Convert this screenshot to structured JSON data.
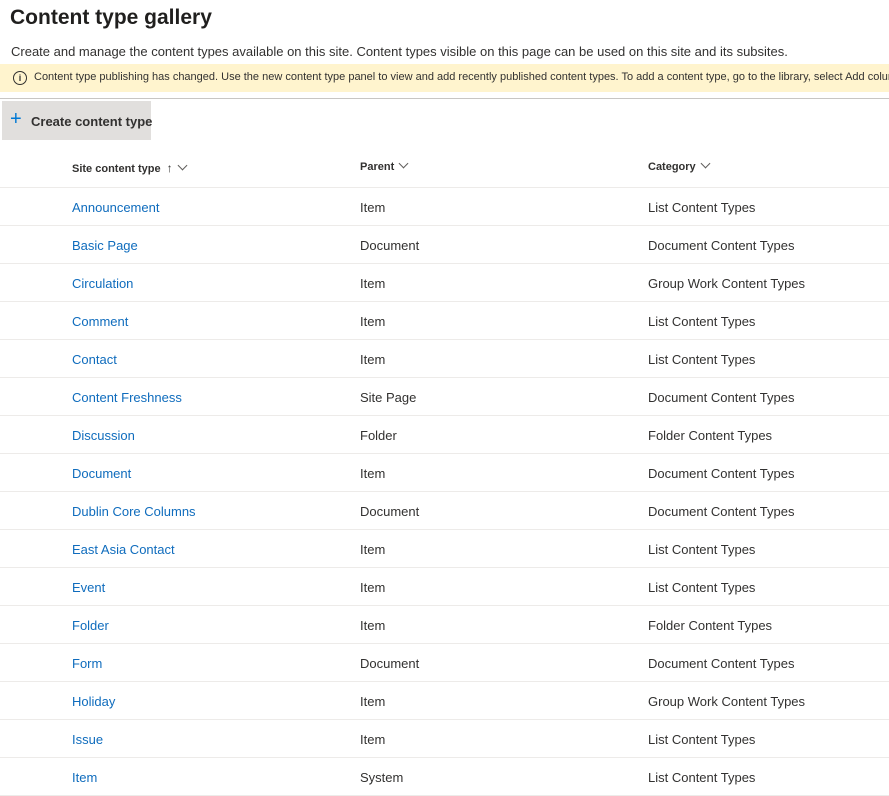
{
  "page": {
    "title": "Content type gallery",
    "description": "Create and manage the content types available on this site. Content types visible on this page can be used on this site and its subsites."
  },
  "notice": {
    "icon": "info-icon",
    "icon_glyph": "i",
    "text": "Content type publishing has changed. Use the new content type panel to view and add recently published content types. To add a content type, go to the library, select Add column",
    "background": "#fff4ce"
  },
  "toolbar": {
    "create_icon": "plus-icon",
    "create_glyph": "+",
    "create_label": "Create content type"
  },
  "table": {
    "columns": [
      {
        "label": "Site content type",
        "sort_icon": "arrow-up-icon",
        "sort_glyph": "↑"
      },
      {
        "label": "Parent"
      },
      {
        "label": "Category"
      }
    ],
    "rows": [
      {
        "name": "Announcement",
        "parent": "Item",
        "category": "List Content Types"
      },
      {
        "name": "Basic Page",
        "parent": "Document",
        "category": "Document Content Types"
      },
      {
        "name": "Circulation",
        "parent": "Item",
        "category": "Group Work Content Types"
      },
      {
        "name": "Comment",
        "parent": "Item",
        "category": "List Content Types"
      },
      {
        "name": "Contact",
        "parent": "Item",
        "category": "List Content Types"
      },
      {
        "name": "Content Freshness",
        "parent": "Site Page",
        "category": "Document Content Types"
      },
      {
        "name": "Discussion",
        "parent": "Folder",
        "category": "Folder Content Types"
      },
      {
        "name": "Document",
        "parent": "Item",
        "category": "Document Content Types"
      },
      {
        "name": "Dublin Core Columns",
        "parent": "Document",
        "category": "Document Content Types"
      },
      {
        "name": "East Asia Contact",
        "parent": "Item",
        "category": "List Content Types"
      },
      {
        "name": "Event",
        "parent": "Item",
        "category": "List Content Types"
      },
      {
        "name": "Folder",
        "parent": "Item",
        "category": "Folder Content Types"
      },
      {
        "name": "Form",
        "parent": "Document",
        "category": "Document Content Types"
      },
      {
        "name": "Holiday",
        "parent": "Item",
        "category": "Group Work Content Types"
      },
      {
        "name": "Issue",
        "parent": "Item",
        "category": "List Content Types"
      },
      {
        "name": "Item",
        "parent": "System",
        "category": "List Content Types"
      }
    ]
  },
  "colors": {
    "link": "#0f6cbd",
    "accent": "#0078d4",
    "button_bg": "#e1dfdd"
  }
}
